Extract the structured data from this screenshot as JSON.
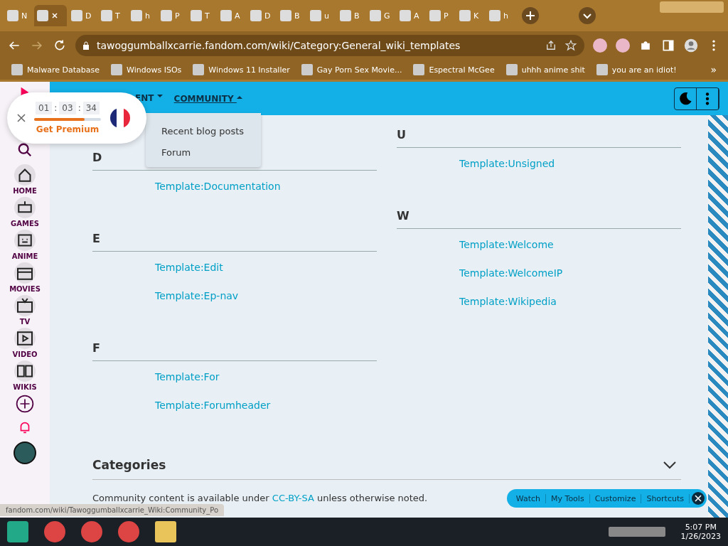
{
  "browser": {
    "tabs": [
      {
        "title": "N",
        "selected": false
      },
      {
        "selected": true
      },
      {
        "title": "D",
        "selected": false
      },
      {
        "title": "T",
        "selected": false
      },
      {
        "title": "h",
        "selected": false
      },
      {
        "title": "P",
        "selected": false
      },
      {
        "title": "T",
        "selected": false
      },
      {
        "title": "A",
        "selected": false
      },
      {
        "title": "D",
        "selected": false
      },
      {
        "title": "B",
        "selected": false
      },
      {
        "title": "u",
        "selected": false
      },
      {
        "title": "B",
        "selected": false
      },
      {
        "title": "G",
        "selected": false
      },
      {
        "title": "A",
        "selected": false
      },
      {
        "title": "P",
        "selected": false
      },
      {
        "title": "K",
        "selected": false
      },
      {
        "title": "h",
        "selected": false
      }
    ],
    "url": "tawoggumballxcarrie.fandom.com/wiki/Category:General_wiki_templates",
    "bookmarks": [
      "Malware Database",
      "Windows ISOs",
      "Windows 11 Installer",
      "Gay Porn Sex Movie...",
      "Espectral McGee",
      "uhhh anime shit",
      "you are an idiot!"
    ],
    "bookmarks_more": "»"
  },
  "wiki": {
    "nav": [
      {
        "label": "ENT",
        "expanded": false
      },
      {
        "label": "COMMUNITY",
        "expanded": true
      }
    ],
    "dropdown": [
      "Recent blog posts",
      "Forum"
    ],
    "sidebar": [
      "HOME",
      "GAMES",
      "ANIME",
      "MOVIES",
      "TV",
      "VIDEO",
      "WIKIS"
    ],
    "columns": [
      [
        {
          "letter": "D",
          "links": [
            "Template:Documentation"
          ]
        },
        {
          "letter": "E",
          "links": [
            "Template:Edit",
            "Template:Ep-nav"
          ]
        },
        {
          "letter": "F",
          "links": [
            "Template:For",
            "Template:Forumheader"
          ]
        }
      ],
      [
        {
          "letter": "U",
          "links": [
            "Template:Unsigned"
          ]
        },
        {
          "letter": "W",
          "links": [
            "Template:Welcome",
            "Template:WelcomeIP",
            "Template:Wikipedia"
          ]
        }
      ]
    ],
    "categories": {
      "title": "Categories",
      "expanded": false
    },
    "footer": {
      "before": "Community content is available under",
      "link": "CC-BY-SA",
      "after": "unless otherwise noted."
    },
    "toolbar": [
      "Watch",
      "My Tools",
      "Customize",
      "Shortcuts"
    ],
    "status_url": "fandom.com/wiki/Tawoggumballxcarrie_Wiki:Community_Po"
  },
  "timer": {
    "hours": "01",
    "minutes": "03",
    "seconds": "34",
    "separator": ":",
    "level": 0.75,
    "cta": "Get Premium"
  },
  "taskbar": {
    "time": "5:07 PM",
    "date": "1/26/2023"
  }
}
